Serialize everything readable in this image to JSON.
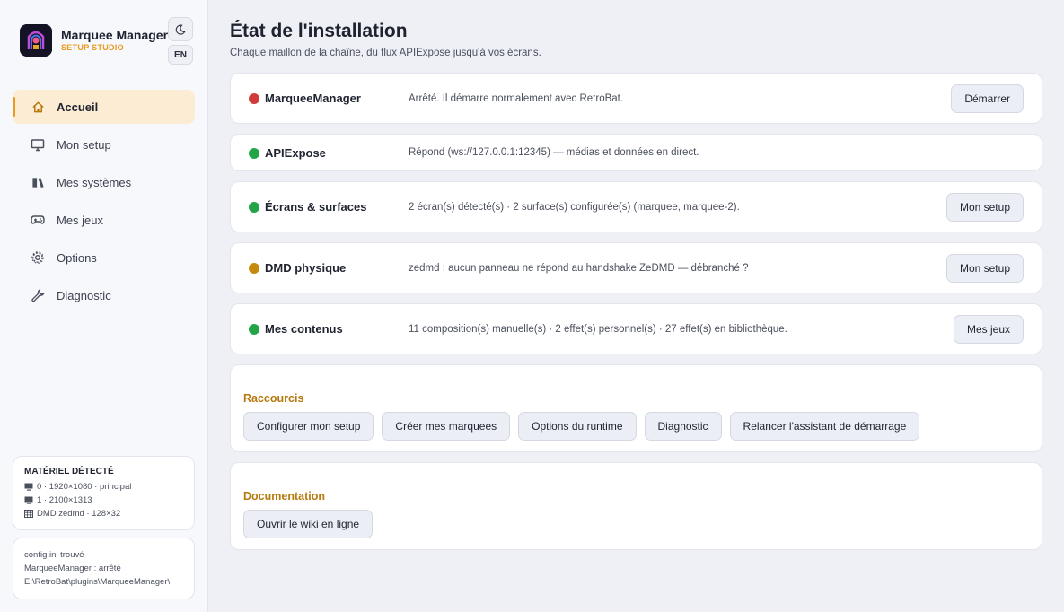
{
  "app": {
    "title": "Marquee Manager",
    "subtitle": "SETUP STUDIO",
    "lang_label": "EN",
    "accent": "#e89a1e"
  },
  "nav": [
    {
      "label": "Accueil",
      "icon": "home-icon",
      "active": true
    },
    {
      "label": "Mon setup",
      "icon": "monitor-icon",
      "active": false
    },
    {
      "label": "Mes systèmes",
      "icon": "systems-icon",
      "active": false
    },
    {
      "label": "Mes jeux",
      "icon": "gamepad-icon",
      "active": false
    },
    {
      "label": "Options",
      "icon": "gear-icon",
      "active": false
    },
    {
      "label": "Diagnostic",
      "icon": "wrench-icon",
      "active": false
    }
  ],
  "hardware": {
    "title": "MATÉRIEL DÉTECTÉ",
    "lines": [
      "0 · 1920×1080 · principal",
      "1 · 2100×1313",
      "DMD zedmd · 128×32"
    ]
  },
  "config": {
    "lines": [
      "config.ini trouvé",
      "MarqueeManager : arrêté",
      "E:\\RetroBat\\plugins\\MarqueeManager\\"
    ]
  },
  "page": {
    "title": "État de l'installation",
    "subtitle": "Chaque maillon de la chaîne, du flux APIExpose jusqu'à vos écrans."
  },
  "status_rows": [
    {
      "name": "MarqueeManager",
      "desc": "Arrêté. Il démarre normalement avec RetroBat.",
      "status": "stopped",
      "color": "#d13b3b",
      "button": "Démarrer"
    },
    {
      "name": "APIExpose",
      "desc": "Répond (ws://127.0.0.1:12345) — médias et données en direct.",
      "status": "ok",
      "color": "#22a447",
      "button": null
    },
    {
      "name": "Écrans & surfaces",
      "desc": "2 écran(s) détecté(s) · 2 surface(s) configurée(s) (marquee, marquee-2).",
      "status": "ok",
      "color": "#22a447",
      "button": "Mon setup"
    },
    {
      "name": "DMD physique",
      "desc": "zedmd : aucun panneau ne répond au handshake ZeDMD — débranché ?",
      "status": "warning",
      "color": "#c48a0e",
      "button": "Mon setup"
    },
    {
      "name": "Mes contenus",
      "desc": "11 composition(s) manuelle(s) · 2 effet(s) personnel(s) · 27 effet(s) en bibliothèque.",
      "status": "ok",
      "color": "#22a447",
      "button": "Mes jeux"
    }
  ],
  "shortcuts": {
    "title": "Raccourcis",
    "buttons": [
      "Configurer mon setup",
      "Créer mes marquees",
      "Options du runtime",
      "Diagnostic",
      "Relancer l'assistant de démarrage"
    ]
  },
  "documentation": {
    "title": "Documentation",
    "button": "Ouvrir le wiki en ligne"
  }
}
